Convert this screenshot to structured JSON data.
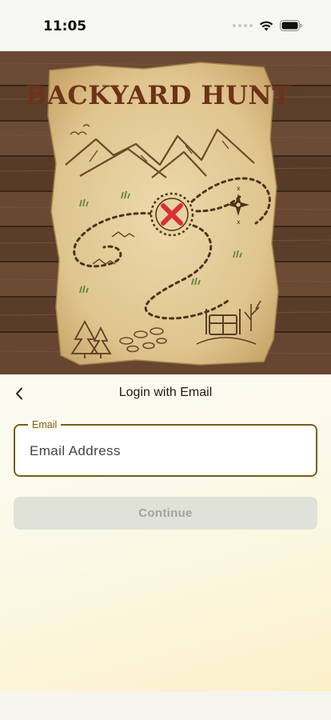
{
  "status_bar": {
    "time": "11:05",
    "icons": [
      "signal-dots-icon",
      "wifi-icon",
      "battery-icon"
    ]
  },
  "hero": {
    "map_title": "BACKYARD HUNT",
    "icons": [
      "mountains-icon",
      "x-mark-icon",
      "compass-rose-icon",
      "pine-trees-icon",
      "treasure-chest-icon"
    ]
  },
  "header": {
    "back_icon": "chevron-left-icon",
    "title": "Login with Email"
  },
  "form": {
    "email_label": "Email",
    "email_placeholder": "Email Address",
    "email_value": "",
    "continue_label": "Continue",
    "continue_enabled": false
  },
  "colors": {
    "accent": "#7a5e16",
    "button_disabled_bg": "#e0e1d8",
    "button_disabled_text": "#a3a59c",
    "map_title": "#6e3219",
    "x_mark": "#d6303a"
  }
}
